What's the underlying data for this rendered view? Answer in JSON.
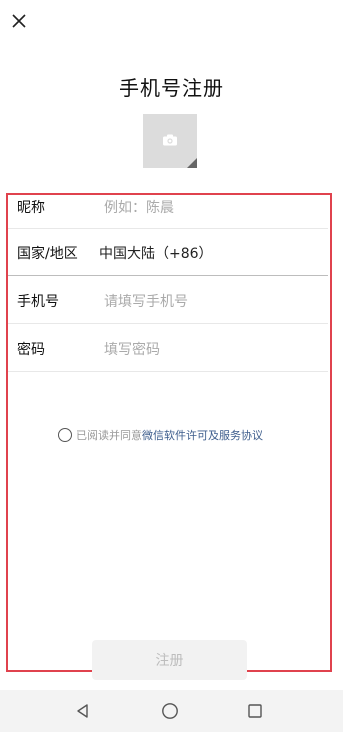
{
  "header": {
    "title": "手机号注册",
    "close_icon": "close-icon",
    "avatar_icon": "camera-icon"
  },
  "form": {
    "rows": [
      {
        "label": "昵称",
        "placeholder": "例如：陈晨"
      },
      {
        "label": "国家/地区",
        "value": "中国大陆（+86）"
      },
      {
        "label": "手机号",
        "placeholder": "请填写手机号"
      },
      {
        "label": "密码",
        "placeholder": "填写密码"
      }
    ]
  },
  "agreement": {
    "prefix": "已阅读并同意",
    "link": "微信软件许可及服务协议"
  },
  "submit": {
    "label": "注册"
  },
  "colors": {
    "highlight_border": "#e0424d",
    "link": "#3d5d8c",
    "button_bg": "#f2f2f2",
    "button_text": "#bdbdbd"
  },
  "navigation": {
    "back_icon": "back-triangle-icon",
    "home_icon": "home-circle-icon",
    "recents_icon": "recents-square-icon"
  }
}
